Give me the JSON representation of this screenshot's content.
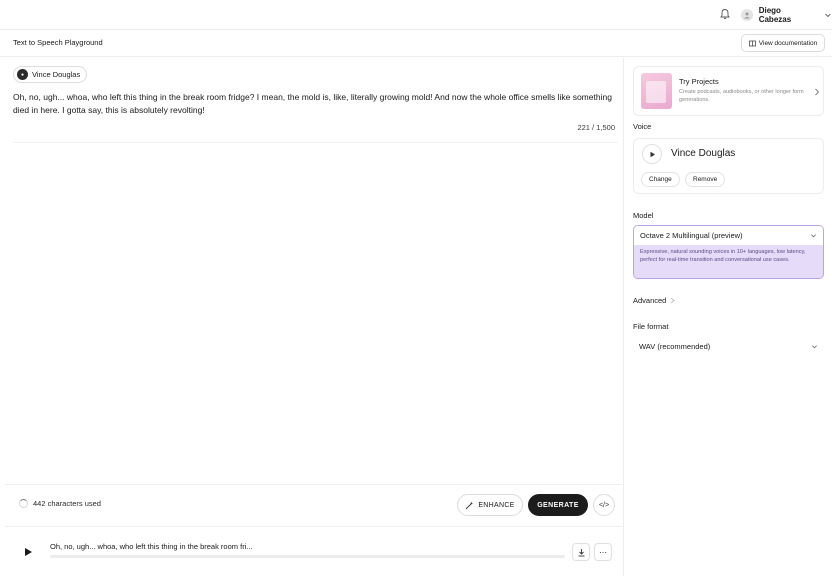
{
  "topbar": {
    "user_name": "Diego Cabezas"
  },
  "subheader": {
    "page_title": "Text to Speech Playground",
    "doc_button": "View documentation"
  },
  "editor": {
    "voice_chip": "Vince Douglas",
    "text": "Oh, no, ugh... whoa, who left this thing in the break room fridge? I mean, the mold is, like, literally growing mold! And now the whole office smells like something died in here. I gotta say, this is absolutely revolting!",
    "counter": "221 / 1,500"
  },
  "actions": {
    "chars_used": "442 characters used",
    "enhance_label": "ENHANCE",
    "generate_label": "GENERATE",
    "code_label": "</>"
  },
  "player": {
    "title": "Oh, no, ugh... whoa, who left this thing in the break room fri...",
    "progress": 0
  },
  "sidebar": {
    "projects": {
      "title": "Try Projects",
      "subtitle": "Create podcasts, audiobooks, or other longer form generations."
    },
    "voice": {
      "label": "Voice",
      "name": "Vince Douglas",
      "change_label": "Change",
      "remove_label": "Remove"
    },
    "model": {
      "label": "Model",
      "selected": "Octave 2 Multilingual (preview)",
      "description": "Expressive, natural sounding voices in 10+ languages, low latency, perfect for real-time transition and conversational use cases."
    },
    "advanced_label": "Advanced",
    "file_format": {
      "label": "File format",
      "selected": "WAV (recommended)"
    }
  },
  "colors": {
    "accent_purple": "#b9a3ec",
    "model_desc_bg": "#e6dcf9",
    "generate_bg": "#1c1c1c"
  }
}
